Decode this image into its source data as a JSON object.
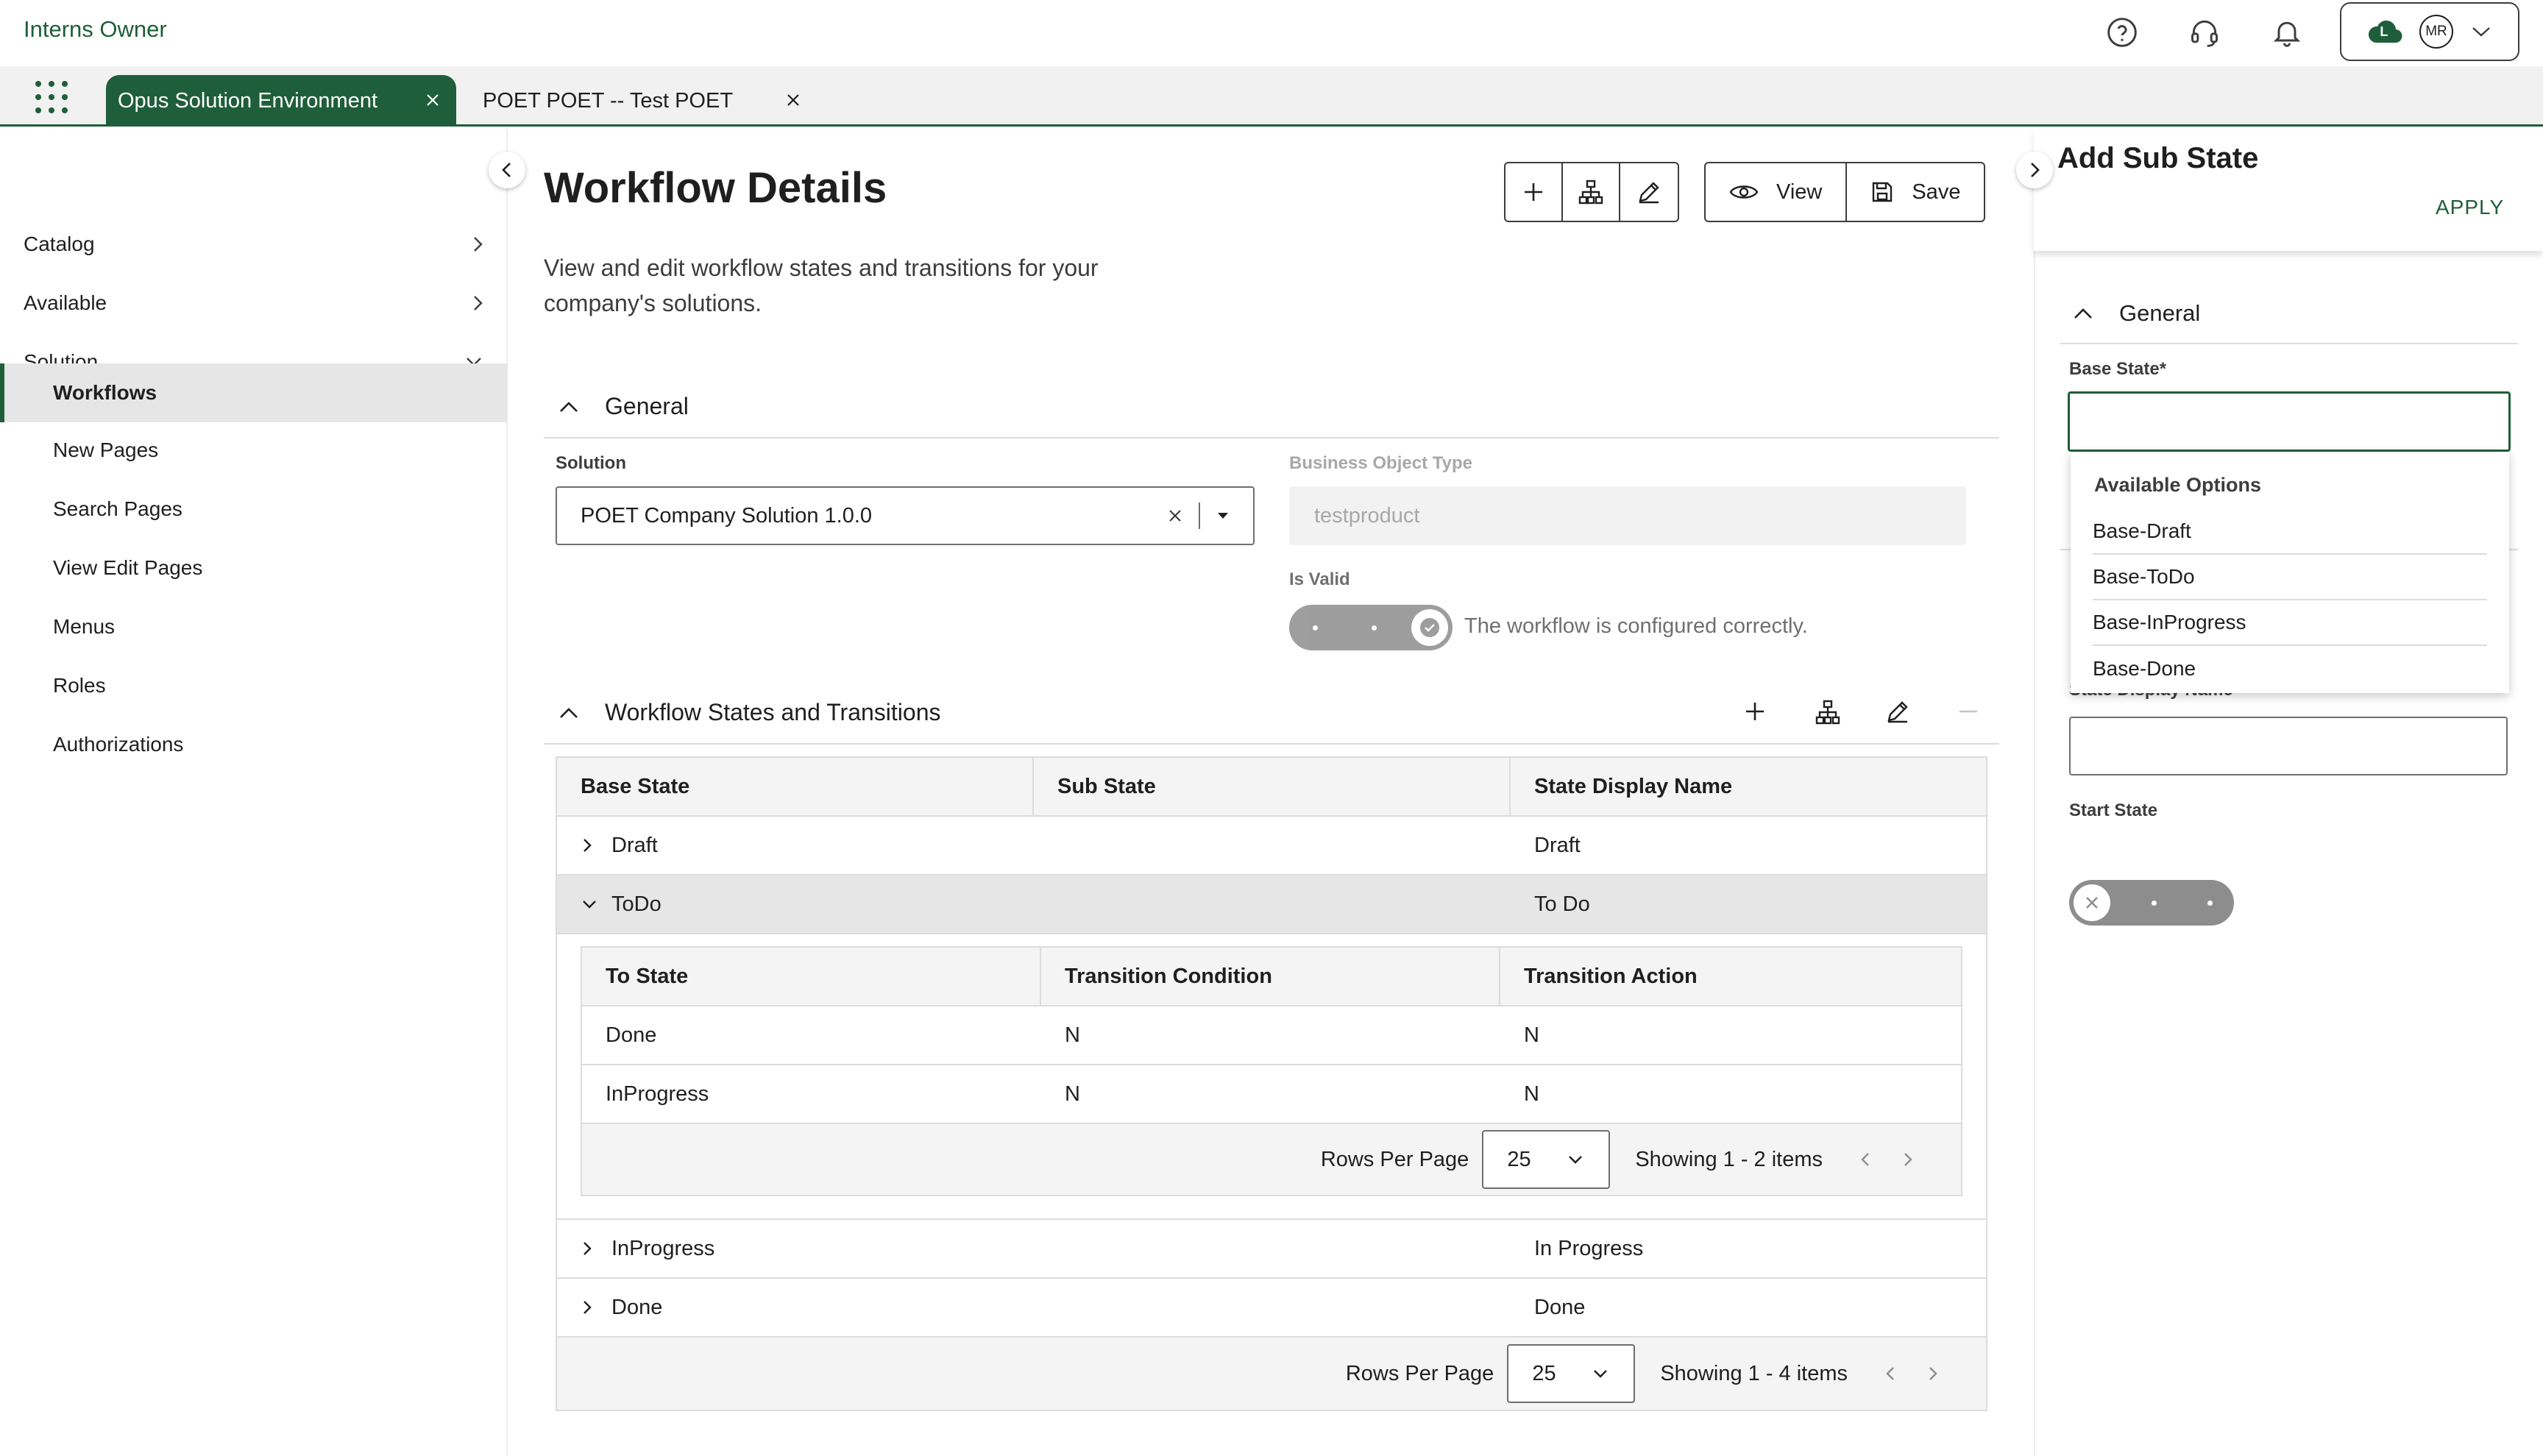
{
  "app": {
    "title": "Interns Owner"
  },
  "header": {
    "user_initials": "MR",
    "cloud_badge": "L",
    "icons": [
      "help-icon",
      "support-headset-icon",
      "notification-bell-icon",
      "cloud-icon",
      "chevron-down-icon"
    ]
  },
  "tabs": [
    {
      "label": "Opus Solution Environment",
      "active": true
    },
    {
      "label": "POET POET -- Test POET",
      "active": false
    }
  ],
  "sidebar": {
    "items": [
      {
        "label": "Catalog",
        "level": 1,
        "expanded": false
      },
      {
        "label": "Available",
        "level": 1,
        "expanded": false
      },
      {
        "label": "Solution",
        "level": 1,
        "expanded": true
      },
      {
        "label": "Workflows",
        "level": 2,
        "active": true
      },
      {
        "label": "New Pages",
        "level": 2
      },
      {
        "label": "Search Pages",
        "level": 2
      },
      {
        "label": "View Edit Pages",
        "level": 2
      },
      {
        "label": "Menus",
        "level": 2
      },
      {
        "label": "Roles",
        "level": 2
      },
      {
        "label": "Authorizations",
        "level": 2
      }
    ]
  },
  "main": {
    "title": "Workflow Details",
    "description": "View and edit workflow states and transitions for your company's solutions.",
    "toolbar": {
      "view_label": "View",
      "save_label": "Save"
    },
    "general": {
      "title": "General",
      "solution_label": "Solution",
      "solution_value": "POET Company Solution 1.0.0",
      "bo_type_label": "Business Object Type",
      "bo_type_value": "testproduct",
      "is_valid_label": "Is Valid",
      "is_valid": true,
      "is_valid_text": "The workflow is configured correctly."
    },
    "states": {
      "title": "Workflow States and Transitions",
      "columns": [
        "Base State",
        "Sub State",
        "State Display Name"
      ],
      "rows": [
        {
          "base": "Draft",
          "sub": "",
          "display": "Draft",
          "expanded": false
        },
        {
          "base": "ToDo",
          "sub": "",
          "display": "To Do",
          "expanded": true
        },
        {
          "base": "InProgress",
          "sub": "",
          "display": "In Progress",
          "expanded": false
        },
        {
          "base": "Done",
          "sub": "",
          "display": "Done",
          "expanded": false
        }
      ],
      "transitions": {
        "columns": [
          "To State",
          "Transition Condition",
          "Transition Action"
        ],
        "rows": [
          {
            "to": "Done",
            "condition": "N",
            "action": "N"
          },
          {
            "to": "InProgress",
            "condition": "N",
            "action": "N"
          }
        ],
        "rows_per_page_label": "Rows Per Page",
        "rows_per_page": "25",
        "showing": "Showing 1 - 2 items"
      },
      "rows_per_page_label": "Rows Per Page",
      "rows_per_page": "25",
      "showing": "Showing 1 - 4 items"
    }
  },
  "panel": {
    "title": "Add Sub State",
    "apply_label": "APPLY",
    "general_title": "General",
    "base_state_label": "Base State*",
    "base_state_value": "",
    "dropdown": {
      "header": "Available Options",
      "options": [
        "Base-Draft",
        "Base-ToDo",
        "Base-InProgress",
        "Base-Done"
      ]
    },
    "display_name_label": "State Display Name*",
    "display_name_value": "",
    "start_state_label": "Start State",
    "start_state": false
  },
  "colors": {
    "brand": "#1f5e3a",
    "toggle_on": "#8d8d8d",
    "toggle_off": "#8d8d8d"
  }
}
